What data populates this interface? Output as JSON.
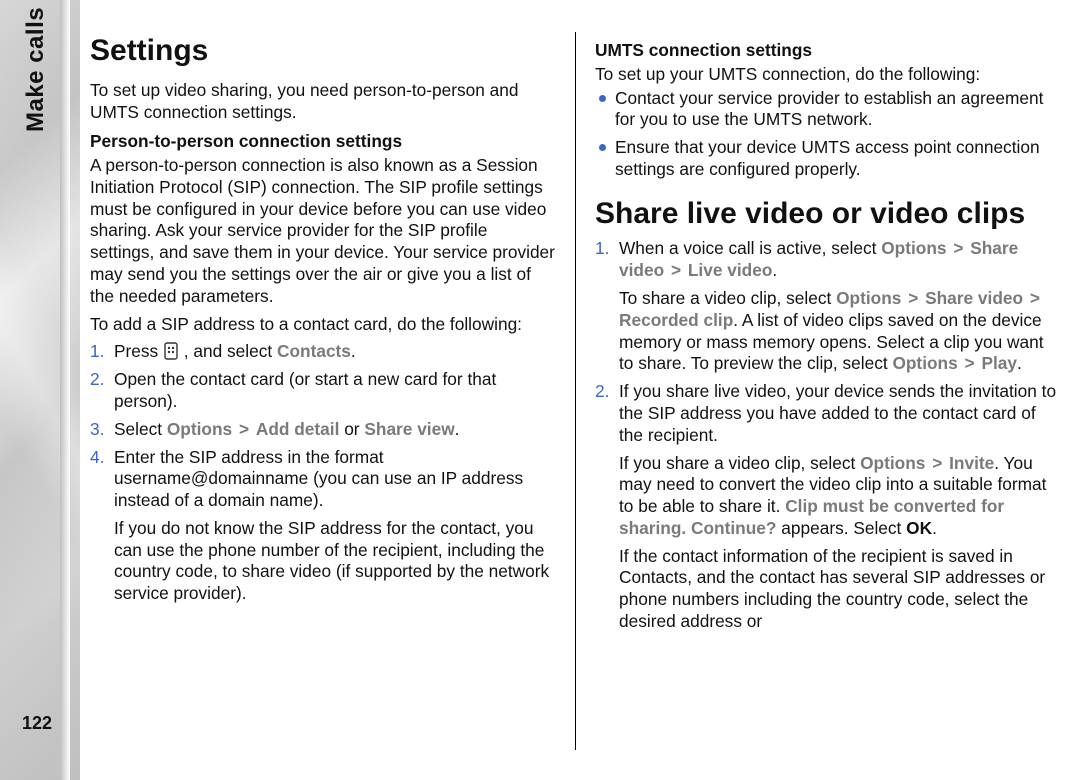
{
  "side": {
    "section_label": "Make calls",
    "page_number": "122"
  },
  "left": {
    "h1": "Settings",
    "intro": "To set up video sharing, you need person-to-person and UMTS connection settings.",
    "p2p_heading": "Person-to-person connection settings",
    "p2p_para": "A person-to-person connection is also known as a Session Initiation Protocol (SIP) connection. The SIP profile settings must be configured in your device before you can use video sharing. Ask your service provider for the SIP profile settings, and save them in your device. Your service provider may send you the settings over the air or give you a list of the needed parameters.",
    "sip_intro": "To add a SIP address to a contact card, do the following:",
    "li1_pre": "Press ",
    "li1_post": " , and select ",
    "li1_contacts": "Contacts",
    "li1_end": ".",
    "li2": "Open the contact card (or start a new card for that person).",
    "li3_pre": "Select ",
    "li3_options": "Options",
    "li3_add": "Add detail",
    "li3_mid": " or ",
    "li3_share": "Share view",
    "li3_end": ".",
    "li4_a": "Enter the SIP address in the format username@domainname (you can use an IP address instead of a domain name).",
    "li4_b": "If you do not know the SIP address for the contact, you can use the phone number of the recipient, including the country code, to share video (if supported by the network service provider)."
  },
  "right": {
    "umts_heading": "UMTS connection settings",
    "umts_intro": "To set up your UMTS connection, do the following:",
    "umts_b1": "Contact your service provider to establish an agreement for you to use the UMTS network.",
    "umts_b2": "Ensure that your device UMTS access point connection settings are configured properly.",
    "share_h1": "Share live video or video clips",
    "s1_a_pre": "When a voice call is active, select ",
    "s1_a_options": "Options",
    "s1_a_share": "Share video",
    "s1_a_live": "Live video",
    "s1_a_end": ".",
    "s1_b_pre": "To share a video clip, select ",
    "s1_b_options": "Options",
    "s1_b_share": "Share video",
    "s1_b_recorded": "Recorded clip",
    "s1_b_mid": ". A list of video clips saved on the device memory or mass memory opens. Select a clip you want to share. To preview the clip, select ",
    "s1_b_options2": "Options",
    "s1_b_play": "Play",
    "s1_b_end": ".",
    "s2_a": "If you share live video, your device sends the invitation to the SIP address you have added to the contact card of the recipient.",
    "s2_b_pre": "If you share a video clip, select ",
    "s2_b_options": "Options",
    "s2_b_invite": "Invite",
    "s2_b_mid": ". You may need to convert the video clip into a suitable format to be able to share it. ",
    "s2_b_clip": "Clip must be converted for sharing. Continue?",
    "s2_b_post": " appears. Select ",
    "s2_b_ok": "OK",
    "s2_b_end": ".",
    "s2_c": "If the contact information of the recipient is saved in Contacts, and the contact has several SIP addresses or phone numbers including the country code, select the desired address or"
  },
  "glyph": {
    "caret": ">"
  }
}
